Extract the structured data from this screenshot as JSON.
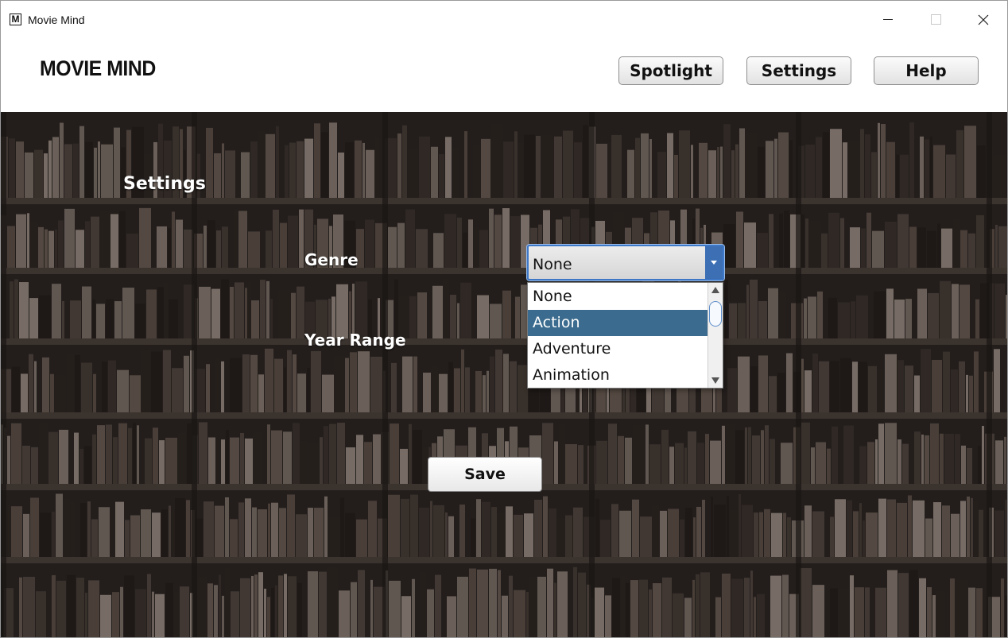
{
  "window": {
    "icon_letter": "M",
    "title": "Movie Mind"
  },
  "header": {
    "brand": "MOVIE MIND",
    "nav": {
      "spotlight": "Spotlight",
      "settings": "Settings",
      "help": "Help"
    }
  },
  "settings": {
    "title": "Settings",
    "genre_label": "Genre",
    "year_range_label": "Year Range",
    "genre_select": {
      "value": "None",
      "options": [
        "None",
        "Action",
        "Adventure",
        "Animation"
      ],
      "highlighted": "Action"
    },
    "save_label": "Save"
  },
  "colors": {
    "accent": "#3d6fb5",
    "selection": "#3b6b8e",
    "background_dark": "#2a2522"
  }
}
